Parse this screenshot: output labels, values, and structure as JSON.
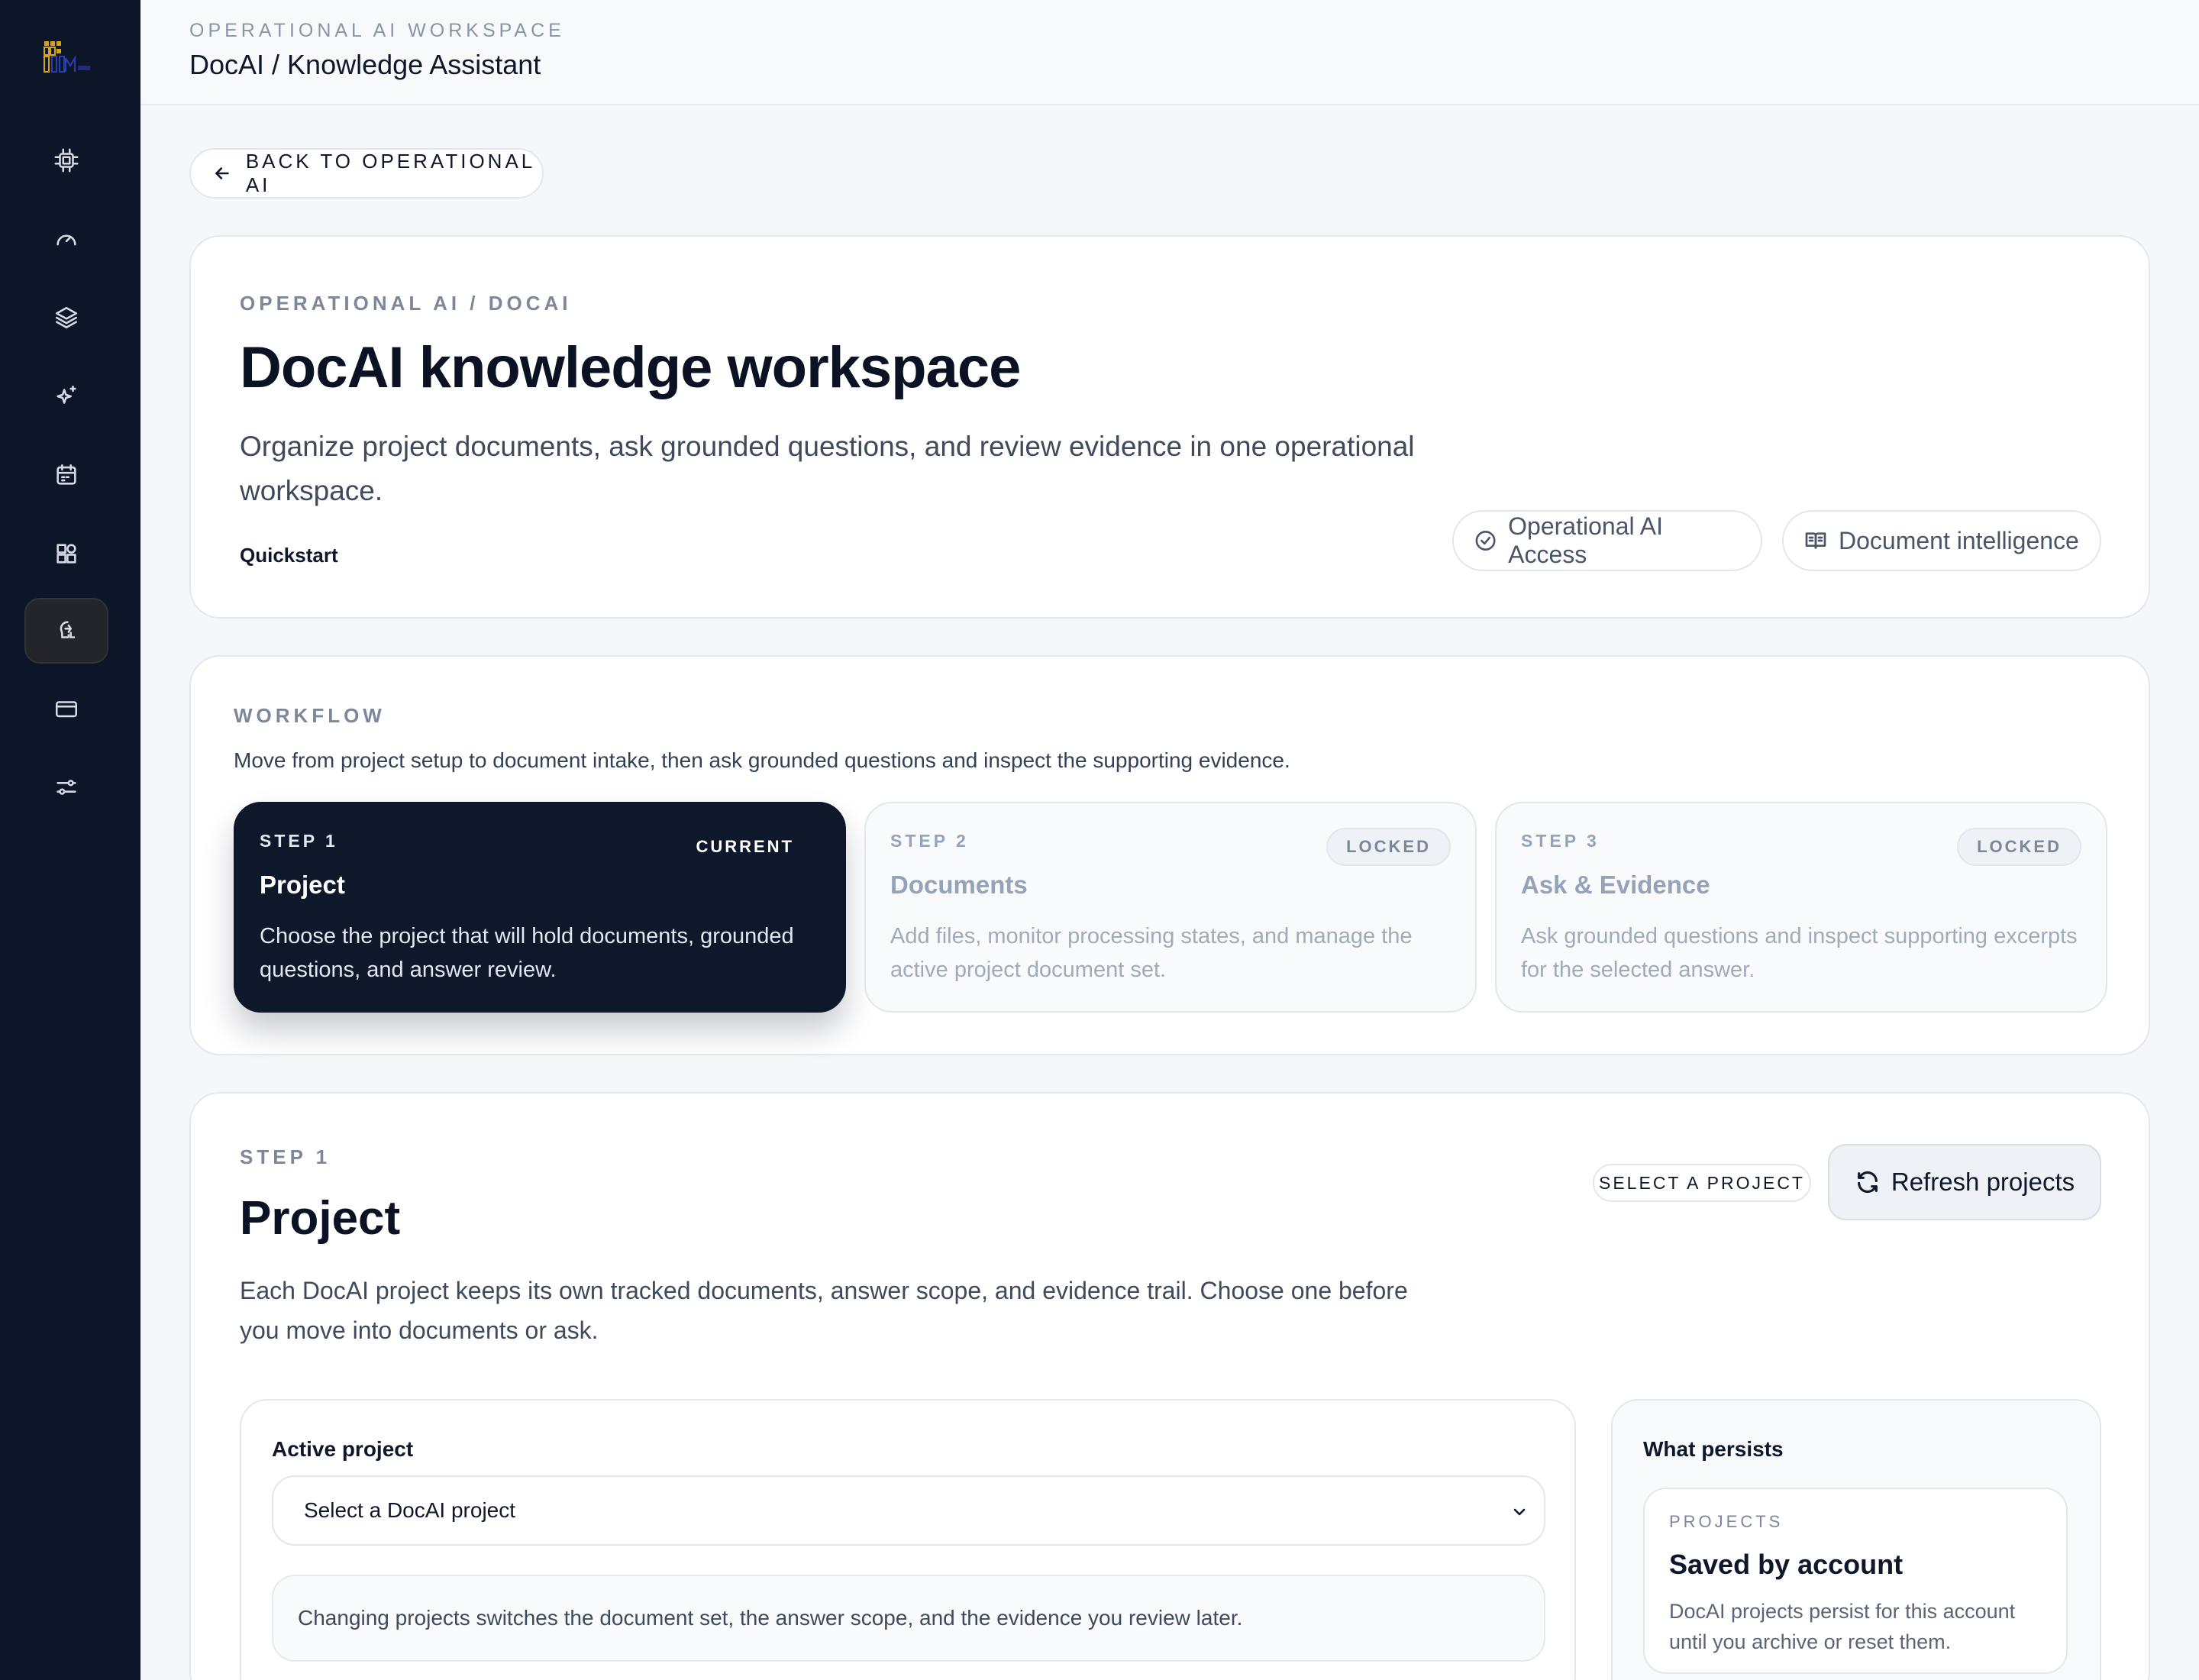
{
  "header": {
    "eyebrow": "OPERATIONAL AI WORKSPACE",
    "title": "DocAI / Knowledge Assistant"
  },
  "sidebar": {
    "logo": "logo-mark",
    "items": [
      {
        "icon": "cpu-icon",
        "active": false
      },
      {
        "icon": "gauge-icon",
        "active": false
      },
      {
        "icon": "layers-icon",
        "active": false
      },
      {
        "icon": "sparkles-icon",
        "active": false
      },
      {
        "icon": "calendar-icon",
        "active": false
      },
      {
        "icon": "widgets-icon",
        "active": false
      },
      {
        "icon": "brain-icon",
        "active": true
      },
      {
        "icon": "card-icon",
        "active": false
      },
      {
        "icon": "sliders-icon",
        "active": false
      }
    ]
  },
  "back_button": {
    "label": "BACK TO OPERATIONAL AI",
    "icon": "arrow-left-icon"
  },
  "hero": {
    "eyebrow": "OPERATIONAL AI / DOCAI",
    "title": "DocAI knowledge workspace",
    "description": "Organize project documents, ask grounded questions, and review evidence in one operational workspace.",
    "quickstart": "Quickstart",
    "pills": [
      {
        "label": "Operational AI Access",
        "icon": "check-circle-icon"
      },
      {
        "label": "Document intelligence",
        "icon": "book-open-icon"
      }
    ]
  },
  "workflow": {
    "eyebrow": "WORKFLOW",
    "description": "Move from project setup to document intake, then ask grounded questions and inspect the supporting evidence.",
    "steps": [
      {
        "step": "STEP 1",
        "badge": "CURRENT",
        "title": "Project",
        "description": "Choose the project that will hold documents, grounded questions, and answer review."
      },
      {
        "step": "STEP 2",
        "badge": "LOCKED",
        "title": "Documents",
        "description": "Add files, monitor processing states, and manage the active project document set."
      },
      {
        "step": "STEP 3",
        "badge": "LOCKED",
        "title": "Ask & Evidence",
        "description": "Ask grounded questions and inspect supporting excerpts for the selected answer."
      }
    ]
  },
  "project": {
    "eyebrow": "STEP 1",
    "title": "Project",
    "description": "Each DocAI project keeps its own tracked documents, answer scope, and evidence trail. Choose one before you move into documents or ask.",
    "status_badge": "SELECT A PROJECT",
    "refresh_label": "Refresh projects",
    "active": {
      "label": "Active project",
      "select_value": "Select a DocAI project",
      "note": "Changing projects switches the document set, the answer scope, and the evidence you review later."
    },
    "persists": {
      "label": "What persists",
      "card_eyebrow": "PROJECTS",
      "card_title": "Saved by account",
      "card_text": "DocAI projects persist for this account until you archive or reset them."
    }
  },
  "colors": {
    "sidebar_bg": "#0c1628",
    "current_step_bg": "#0f172a",
    "logo_gold": "#d8a21f",
    "logo_blue": "#2c3fb0"
  }
}
